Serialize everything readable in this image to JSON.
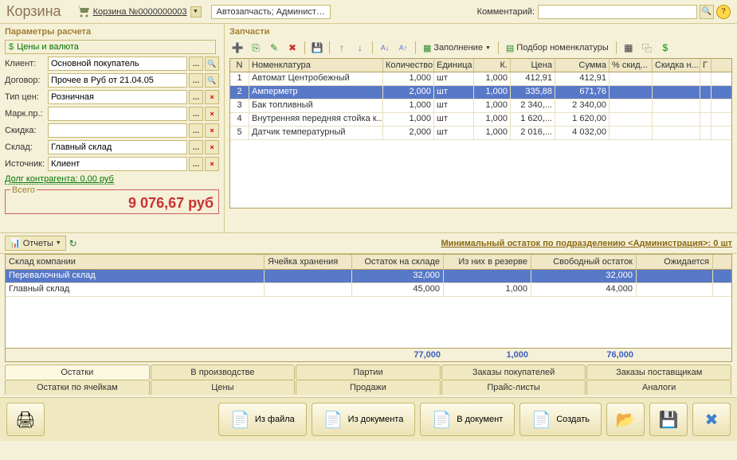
{
  "header": {
    "title": "Корзина",
    "cart_num": "Корзина №0000000003",
    "breadcrumb": "Автозапчасть; Админист…",
    "comment_label": "Комментарий:",
    "comment_value": ""
  },
  "left": {
    "panel_title": "Параметры расчета",
    "prices_link": "Цены и валюта",
    "fields": {
      "client_lbl": "Клиент:",
      "client_val": "Основной покупатель",
      "contract_lbl": "Договор:",
      "contract_val": "Прочее в Руб от 21.04.05",
      "pricetype_lbl": "Тип цен:",
      "pricetype_val": "Розничная",
      "mark_lbl": "Марк.пр.:",
      "mark_val": "",
      "discount_lbl": "Скидка:",
      "discount_val": "",
      "warehouse_lbl": "Склад:",
      "warehouse_val": "Главный склад",
      "source_lbl": "Источник:",
      "source_val": "Клиент"
    },
    "debt_link": "Долг контрагента: 0,00 руб",
    "total_lbl": "Всего",
    "total_val": "9 076,67 руб"
  },
  "parts": {
    "panel_title": "Запчасти",
    "toolbar": {
      "fill": "Заполнение",
      "pick": "Подбор номенклатуры"
    },
    "columns": {
      "n": "N",
      "nom": "Номенклатура",
      "qty": "Количество",
      "unit": "Единица",
      "k": "К.",
      "price": "Цена",
      "sum": "Сумма",
      "pct": "% скид...",
      "disc": "Скидка н...",
      "g": "Г"
    },
    "rows": [
      {
        "n": "1",
        "nom": "Автомат Центробежный",
        "qty": "1,000",
        "unit": "шт",
        "k": "1,000",
        "price": "412,91",
        "sum": "412,91",
        "pct": "",
        "disc": ""
      },
      {
        "n": "2",
        "nom": "Амперметр",
        "qty": "2,000",
        "unit": "шт",
        "k": "1,000",
        "price": "335,88",
        "sum": "671,76",
        "pct": "",
        "disc": ""
      },
      {
        "n": "3",
        "nom": "Бак топливный",
        "qty": "1,000",
        "unit": "шт",
        "k": "1,000",
        "price": "2 340,...",
        "sum": "2 340,00",
        "pct": "",
        "disc": ""
      },
      {
        "n": "4",
        "nom": "Внутренняя передняя стойка к...",
        "qty": "1,000",
        "unit": "шт",
        "k": "1,000",
        "price": "1 620,...",
        "sum": "1 620,00",
        "pct": "",
        "disc": ""
      },
      {
        "n": "5",
        "nom": "Датчик температурный",
        "qty": "2,000",
        "unit": "шт",
        "k": "1,000",
        "price": "2 016,...",
        "sum": "4 032,00",
        "pct": "",
        "disc": ""
      }
    ]
  },
  "reports": {
    "btn": "Отчеты",
    "min_stock": "Минимальный остаток по подразделению <Администрация>: 0 шт"
  },
  "stock": {
    "columns": {
      "wh": "Склад компании",
      "cell": "Ячейка хранения",
      "stock": "Остаток на складе",
      "res": "Из них в резерве",
      "free": "Свободный остаток",
      "exp": "Ожидается"
    },
    "rows": [
      {
        "wh": "Перевалочный склад",
        "cell": "",
        "stock": "32,000",
        "res": "",
        "free": "32,000",
        "exp": ""
      },
      {
        "wh": "Главный склад",
        "cell": "",
        "stock": "45,000",
        "res": "1,000",
        "free": "44,000",
        "exp": ""
      }
    ],
    "footer": {
      "stock": "77,000",
      "res": "1,000",
      "free": "76,000",
      "exp": ""
    }
  },
  "tabs": {
    "row1": [
      "Остатки",
      "В производстве",
      "Партии",
      "Заказы покупателей",
      "Заказы поставщикам"
    ],
    "row2": [
      "Остатки по ячейкам",
      "Цены",
      "Продажи",
      "Прайс-листы",
      "Аналоги"
    ]
  },
  "bottom": {
    "from_file": "Из файла",
    "from_doc": "Из документа",
    "to_doc": "В документ",
    "create": "Создать"
  }
}
